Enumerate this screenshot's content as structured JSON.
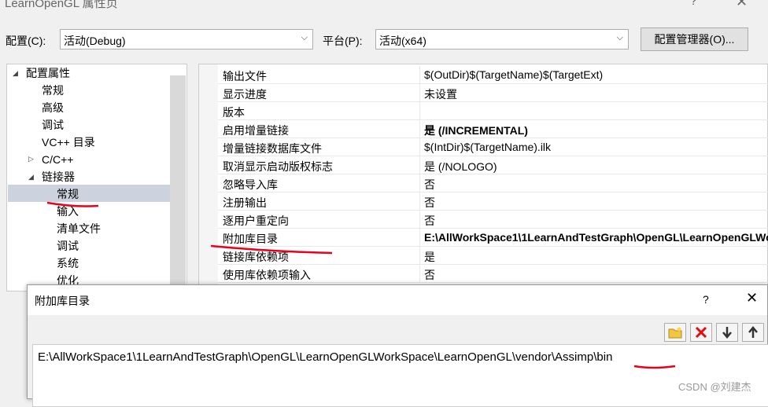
{
  "window": {
    "title": "LearnOpenGL 属性页",
    "help_glyph": "?",
    "close_glyph": "✕"
  },
  "config": {
    "config_label": "配置(C):",
    "config_value": "活动(Debug)",
    "platform_label": "平台(P):",
    "platform_value": "活动(x64)",
    "manager_button": "配置管理器(O)..."
  },
  "tree": {
    "root": "配置属性",
    "items": [
      {
        "label": "常规"
      },
      {
        "label": "高级"
      },
      {
        "label": "调试"
      },
      {
        "label": "VC++ 目录"
      },
      {
        "label": "C/C++"
      },
      {
        "label": "链接器"
      },
      {
        "label": "常规"
      },
      {
        "label": "输入"
      },
      {
        "label": "清单文件"
      },
      {
        "label": "调试"
      },
      {
        "label": "系统"
      },
      {
        "label": "优化"
      }
    ]
  },
  "grid": {
    "rows": [
      {
        "name": "输出文件",
        "value": "$(OutDir)$(TargetName)$(TargetExt)"
      },
      {
        "name": "显示进度",
        "value": "未设置"
      },
      {
        "name": "版本",
        "value": ""
      },
      {
        "name": "启用增量链接",
        "value": "是 (/INCREMENTAL)"
      },
      {
        "name": "增量链接数据库文件",
        "value": "$(IntDir)$(TargetName).ilk"
      },
      {
        "name": "取消显示启动版权标志",
        "value": "是 (/NOLOGO)"
      },
      {
        "name": "忽略导入库",
        "value": "否"
      },
      {
        "name": "注册输出",
        "value": "否"
      },
      {
        "name": "逐用户重定向",
        "value": "否"
      },
      {
        "name": "附加库目录",
        "value": "E:\\AllWorkSpace1\\1LearnAndTestGraph\\OpenGL\\LearnOpenGLWorkSpace\\LearnOpenGL\\vendor\\Assimp\\bin"
      },
      {
        "name": "链接库依赖项",
        "value": "是"
      },
      {
        "name": "使用库依赖项输入",
        "value": "否"
      }
    ]
  },
  "dialog": {
    "title": "附加库目录",
    "help_glyph": "?",
    "close_glyph": "✕",
    "tools": [
      "new-folder-icon",
      "delete-icon",
      "move-down-icon",
      "move-up-icon"
    ],
    "path": "E:\\AllWorkSpace1\\1LearnAndTestGraph\\OpenGL\\LearnOpenGLWorkSpace\\LearnOpenGL\\vendor\\Assimp\\bin"
  },
  "watermark": "CSDN @刘建杰",
  "colors": {
    "annotation": "#e8001c",
    "selection": "#cdd3de"
  }
}
